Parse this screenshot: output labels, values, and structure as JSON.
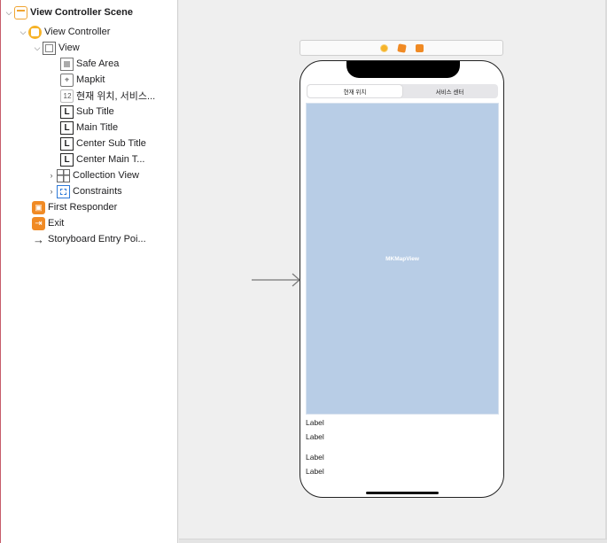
{
  "outline": {
    "scene": "View Controller Scene",
    "view_controller": "View Controller",
    "view": "View",
    "children": [
      {
        "label": "Safe Area",
        "icon": "safe-area-icon"
      },
      {
        "label": "Mapkit",
        "icon": "map-view-icon"
      },
      {
        "label": "현재 위치, 서비스...",
        "icon": "segmented-control-icon"
      },
      {
        "label": "Sub Title",
        "icon": "label-icon"
      },
      {
        "label": "Main Title",
        "icon": "label-icon"
      },
      {
        "label": "Center Sub Title",
        "icon": "label-icon"
      },
      {
        "label": "Center Main T...",
        "icon": "label-icon"
      },
      {
        "label": "Collection View",
        "icon": "collection-view-icon"
      },
      {
        "label": "Constraints",
        "icon": "constraints-icon"
      }
    ],
    "first_responder": "First Responder",
    "exit": "Exit",
    "entry_point": "Storyboard Entry Poi..."
  },
  "canvas": {
    "segments": [
      "현재 위치",
      "서비스 센터"
    ],
    "map_label": "MKMapView",
    "labels": [
      "Label",
      "Label",
      "Label",
      "Label"
    ]
  },
  "colors": {
    "accent_orange": "#f08a24",
    "vc_yellow": "#f6b329",
    "map_blue": "#b8cde6",
    "constraint_blue": "#2e7ad8"
  }
}
